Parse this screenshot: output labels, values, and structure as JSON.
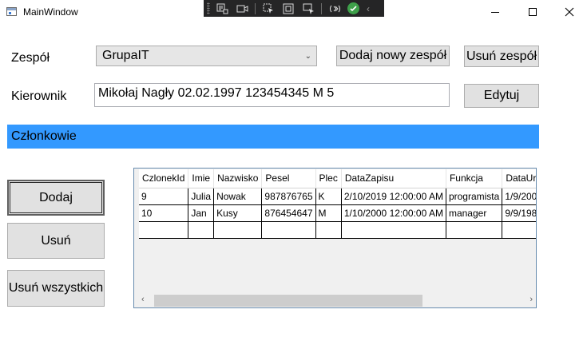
{
  "window": {
    "title": "MainWindow"
  },
  "team": {
    "label": "Zespół",
    "selected": "GrupaIT",
    "add_button": "Dodaj nowy zespół",
    "remove_button": "Usuń zespół"
  },
  "manager": {
    "label": "Kierownik",
    "value": "Mikołaj Nagły 02.02.1997 123454345 M 5",
    "edit_button": "Edytuj"
  },
  "members": {
    "header": "Członkowie",
    "columns": [
      "CzlonekId",
      "Imie",
      "Nazwisko",
      "Pesel",
      "Plec",
      "DataZapisu",
      "Funkcja",
      "DataUr"
    ],
    "rows": [
      [
        "9",
        "Julia",
        "Nowak",
        "987876765",
        "K",
        "2/10/2019 12:00:00 AM",
        "programista",
        "1/9/200"
      ],
      [
        "10",
        "Jan",
        "Kusy",
        "876454647",
        "M",
        "1/10/2000 12:00:00 AM",
        "manager",
        "9/9/198"
      ]
    ]
  },
  "actions": {
    "add": "Dodaj",
    "remove": "Usuń",
    "remove_all": "Usuń wszystkich"
  },
  "colors": {
    "band": "#3399ff",
    "button": "#e1e1e1",
    "devbar": "#252526"
  }
}
